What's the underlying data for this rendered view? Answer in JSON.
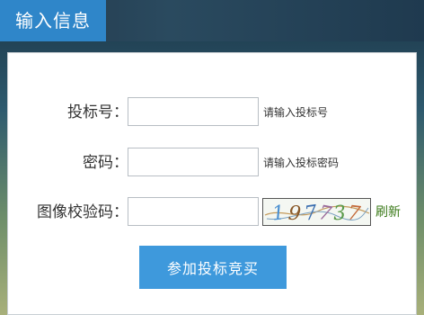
{
  "header": {
    "title": "输入信息"
  },
  "form": {
    "bid_no": {
      "label": "投标号：",
      "value": "",
      "hint": "请输入投标号"
    },
    "password": {
      "label": "密码：",
      "value": "",
      "hint": "请输入投标密码"
    },
    "captcha": {
      "label": "图像校验码：",
      "value": "",
      "image_text": "197737",
      "refresh_label": "刷新"
    },
    "submit_label": "参加投标竞买"
  },
  "colors": {
    "tab": "#2f86c9",
    "button": "#3e99dc",
    "refresh": "#3a7a18"
  }
}
